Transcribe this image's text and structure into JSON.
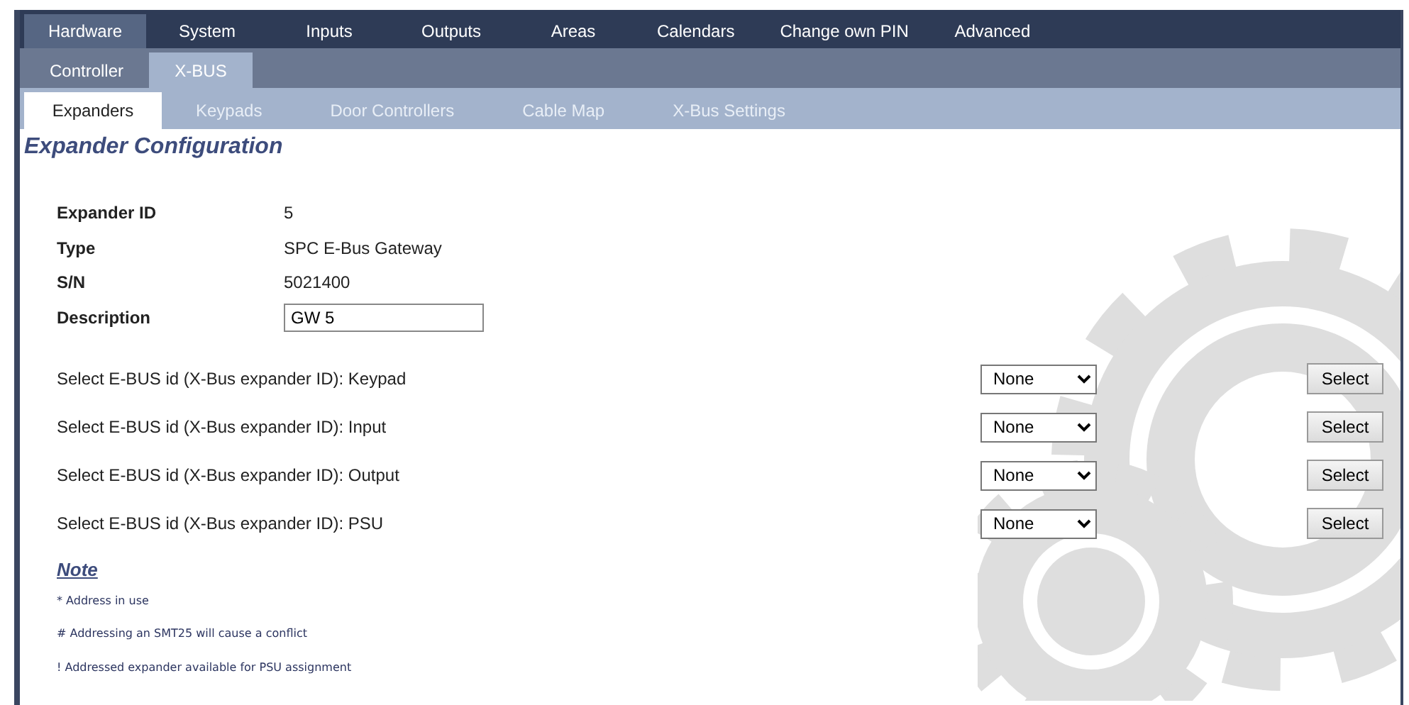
{
  "main_tabs": [
    {
      "label": "Hardware",
      "selected": true
    },
    {
      "label": "System",
      "selected": false
    },
    {
      "label": "Inputs",
      "selected": false
    },
    {
      "label": "Outputs",
      "selected": false
    },
    {
      "label": "Areas",
      "selected": false
    },
    {
      "label": "Calendars",
      "selected": false
    },
    {
      "label": "Change own PIN",
      "selected": false
    },
    {
      "label": "Advanced",
      "selected": false
    }
  ],
  "sub_tabs": [
    {
      "label": "Controller",
      "selected": false
    },
    {
      "label": "X-BUS",
      "selected": true
    }
  ],
  "section_tabs": [
    {
      "label": "Expanders",
      "selected": true
    },
    {
      "label": "Keypads",
      "selected": false
    },
    {
      "label": "Door Controllers",
      "selected": false
    },
    {
      "label": "Cable Map",
      "selected": false
    },
    {
      "label": "X-Bus Settings",
      "selected": false
    }
  ],
  "title": "Expander Configuration",
  "fields": [
    {
      "label": "Expander ID",
      "value": "5",
      "kind": "text"
    },
    {
      "label": "Type",
      "value": "SPC E-Bus Gateway",
      "kind": "text"
    },
    {
      "label": "S/N",
      "value": "5021400",
      "kind": "text"
    },
    {
      "label": "Description",
      "value": "GW 5",
      "kind": "input"
    }
  ],
  "assignments": [
    {
      "label": "Select E-BUS id (X-Bus expander ID): Keypad",
      "value": "None",
      "button": "Select"
    },
    {
      "label": "Select E-BUS id (X-Bus expander ID): Input",
      "value": "None",
      "button": "Select"
    },
    {
      "label": "Select E-BUS id (X-Bus expander ID): Output",
      "value": "None",
      "button": "Select"
    },
    {
      "label": "Select E-BUS id (X-Bus expander ID): PSU",
      "value": "None",
      "button": "Select"
    }
  ],
  "note": {
    "heading": "Note",
    "lines": [
      "* Address in use",
      "# Addressing an SMT25 will cause a conflict",
      "! Addressed expander available for PSU assignment"
    ]
  }
}
